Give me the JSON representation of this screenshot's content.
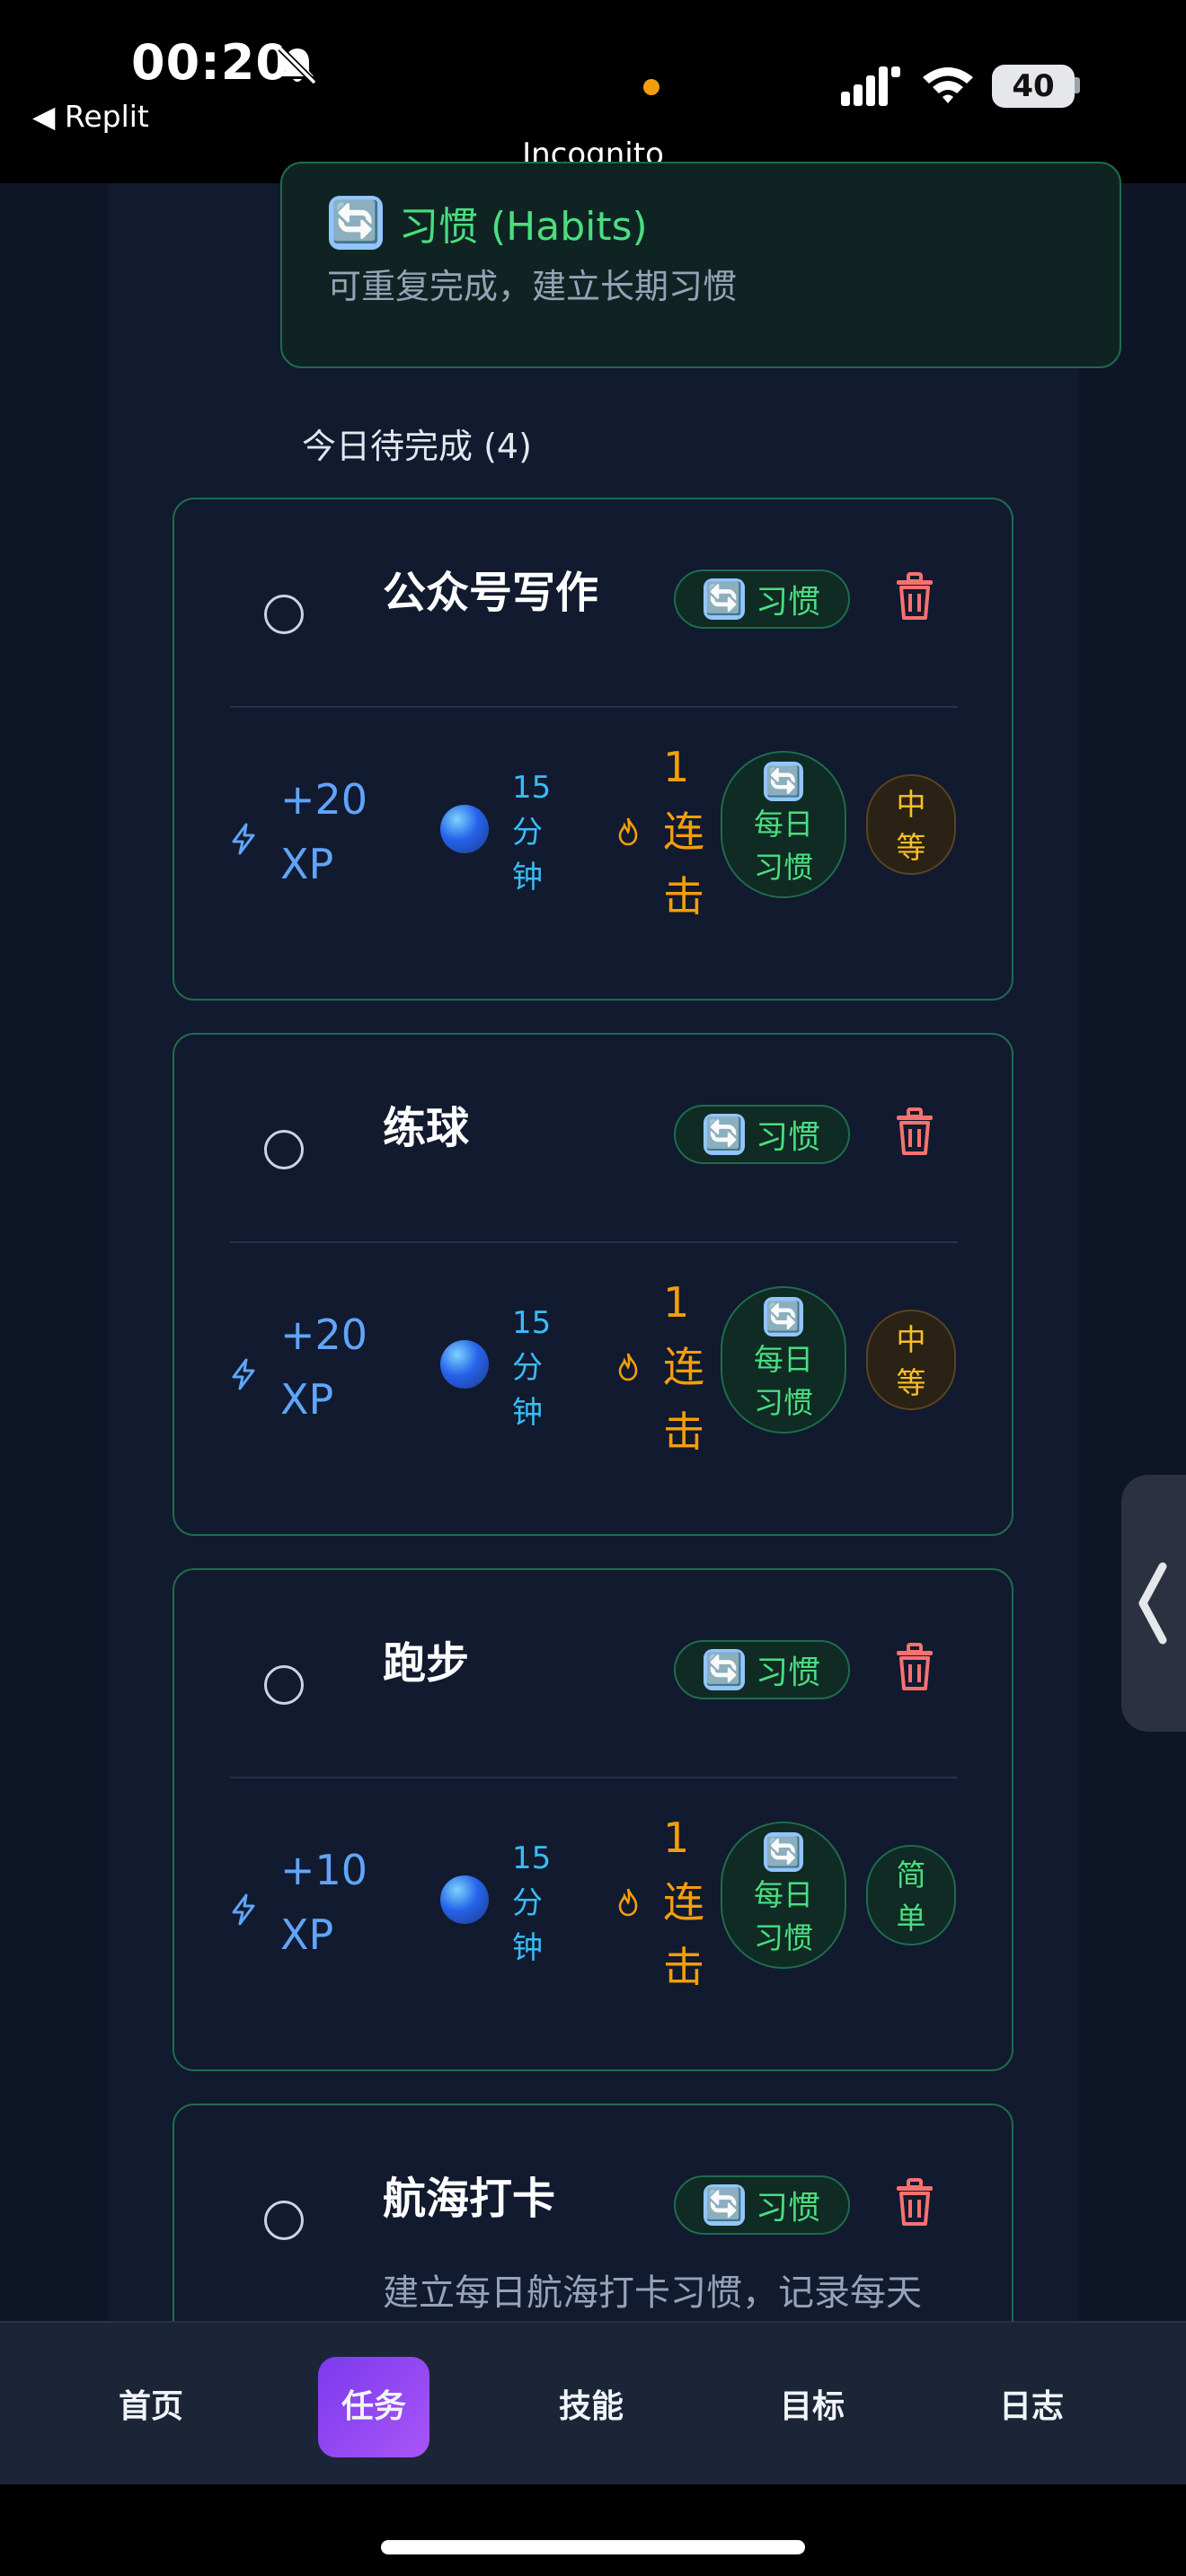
{
  "status_bar": {
    "time": "00:20",
    "back_app": "◀ Replit",
    "battery": "40",
    "tab_mode": "Incognito"
  },
  "section": {
    "emoji": "🔄",
    "title": "习惯 (Habits)",
    "description": "可重复完成，建立长期习惯"
  },
  "pending_heading": "今日待完成 (4)",
  "tasks": [
    {
      "title": "公众号写作",
      "type_label": "习惯",
      "xp_line1": "+20",
      "xp_line2": "XP",
      "duration": [
        "15",
        "分",
        "钟"
      ],
      "streak": [
        "1",
        "连",
        "击"
      ],
      "daily": [
        "每日",
        "习惯"
      ],
      "difficulty": [
        "中",
        "等"
      ],
      "difficulty_level": "medium"
    },
    {
      "title": "练球",
      "type_label": "习惯",
      "xp_line1": "+20",
      "xp_line2": "XP",
      "duration": [
        "15",
        "分",
        "钟"
      ],
      "streak": [
        "1",
        "连",
        "击"
      ],
      "daily": [
        "每日",
        "习惯"
      ],
      "difficulty": [
        "中",
        "等"
      ],
      "difficulty_level": "medium"
    },
    {
      "title": "跑步",
      "type_label": "习惯",
      "xp_line1": "+10",
      "xp_line2": "XP",
      "duration": [
        "15",
        "分",
        "钟"
      ],
      "streak": [
        "1",
        "连",
        "击"
      ],
      "daily": [
        "每日",
        "习惯"
      ],
      "difficulty": [
        "简",
        "单"
      ],
      "difficulty_level": "easy"
    },
    {
      "title": "航海打卡",
      "type_label": "习惯",
      "description": "建立每日航海打卡习惯，记录每天"
    }
  ],
  "nav": {
    "items": [
      "首页",
      "任务",
      "技能",
      "目标",
      "日志"
    ],
    "active_index": 1
  },
  "colors": {
    "habit_green": "#4ade80",
    "xp_blue": "#60a5fa",
    "streak_orange": "#f59e0b",
    "delete_red": "#f87171",
    "active_nav_purple": "#8b5cf6"
  }
}
